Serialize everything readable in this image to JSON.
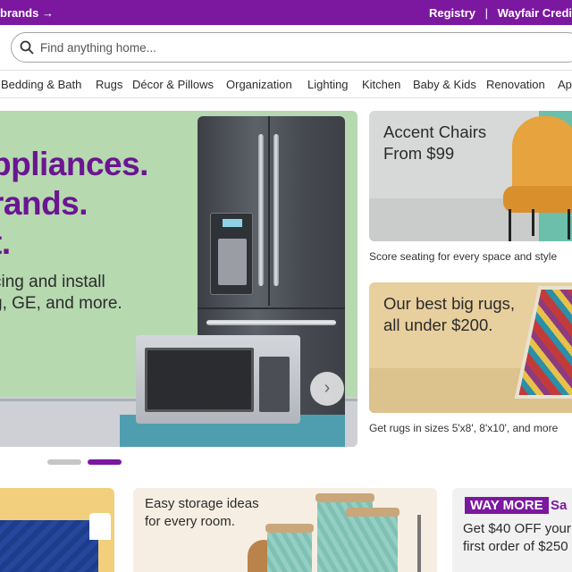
{
  "topbar": {
    "promo": "brands →",
    "links": [
      "Registry",
      "Wayfair Credi"
    ],
    "separator": "|"
  },
  "search": {
    "placeholder": "Find anything home..."
  },
  "nav": {
    "items": [
      "Bedding & Bath",
      "Rugs",
      "Décor & Pillows",
      "Organization",
      "Lighting",
      "Kitchen",
      "Baby & Kids",
      "Renovation",
      "Ap"
    ]
  },
  "hero": {
    "headline": [
      "ppliances.",
      "rands.",
      "t."
    ],
    "body": [
      "cing and install",
      "g, GE, and more."
    ],
    "next_icon": "chevron-right-icon"
  },
  "cards": [
    {
      "title": [
        "Accent Chairs",
        "From $99"
      ],
      "caption": "Score seating for every space and style"
    },
    {
      "title": [
        "Our best big rugs,",
        "all under $200."
      ],
      "caption": "Get rugs in sizes 5'x8', 8'x10', and more"
    }
  ],
  "bottom": {
    "storage": [
      "Easy storage ideas",
      "for every room."
    ],
    "waymore_badge": "WAY MORE",
    "waymore_suffix": "Sa",
    "offer": [
      "Get $40 OFF your",
      "first order of $250"
    ]
  },
  "colors": {
    "brand_purple": "#7b189f",
    "hero_green": "#b6d9b0",
    "headline_purple": "#6b1591"
  }
}
